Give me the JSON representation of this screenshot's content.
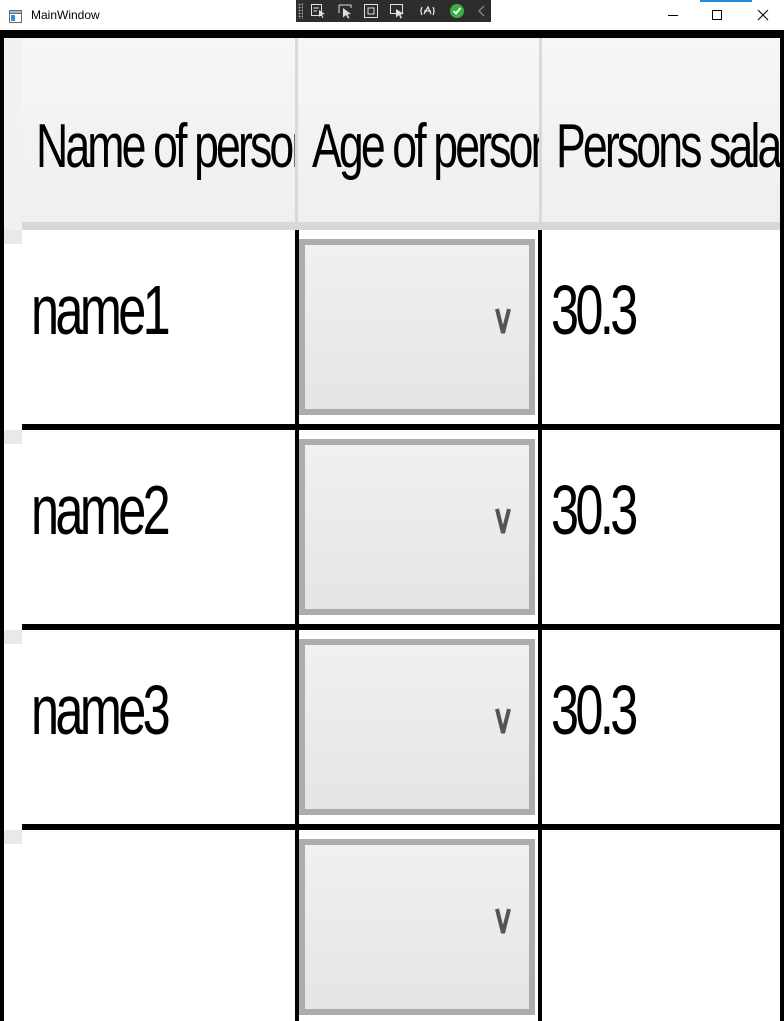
{
  "window": {
    "title": "MainWindow"
  },
  "icons": {
    "app": "app-window-icon",
    "debug_tools": [
      "select-element-icon",
      "pointer-select-icon",
      "layout-adorner-icon",
      "track-focus-icon",
      "binding-failures-icon",
      "hot-reload-ok-icon",
      "collapse-toolbar-icon"
    ],
    "minimize": "minimize-icon",
    "maximize": "maximize-icon",
    "close": "close-icon",
    "dropdown": "chevron-down-icon"
  },
  "grid": {
    "columns": [
      "Name of person",
      "Age of person",
      "Persons salary"
    ],
    "rows": [
      {
        "name": "name1",
        "age": "",
        "salary": "30.3"
      },
      {
        "name": "name2",
        "age": "",
        "salary": "30.3"
      },
      {
        "name": "name3",
        "age": "",
        "salary": "30.3"
      },
      {
        "name": "",
        "age": "",
        "salary": ""
      }
    ]
  },
  "colors": {
    "grid_lines": "#000000",
    "header_bg": "#f2f2f4",
    "combo_border": "#acacac",
    "combo_bg": "#e9e9e9",
    "debug_toolbar": "#2d2d30",
    "hot_reload_ok": "#3cb043"
  }
}
